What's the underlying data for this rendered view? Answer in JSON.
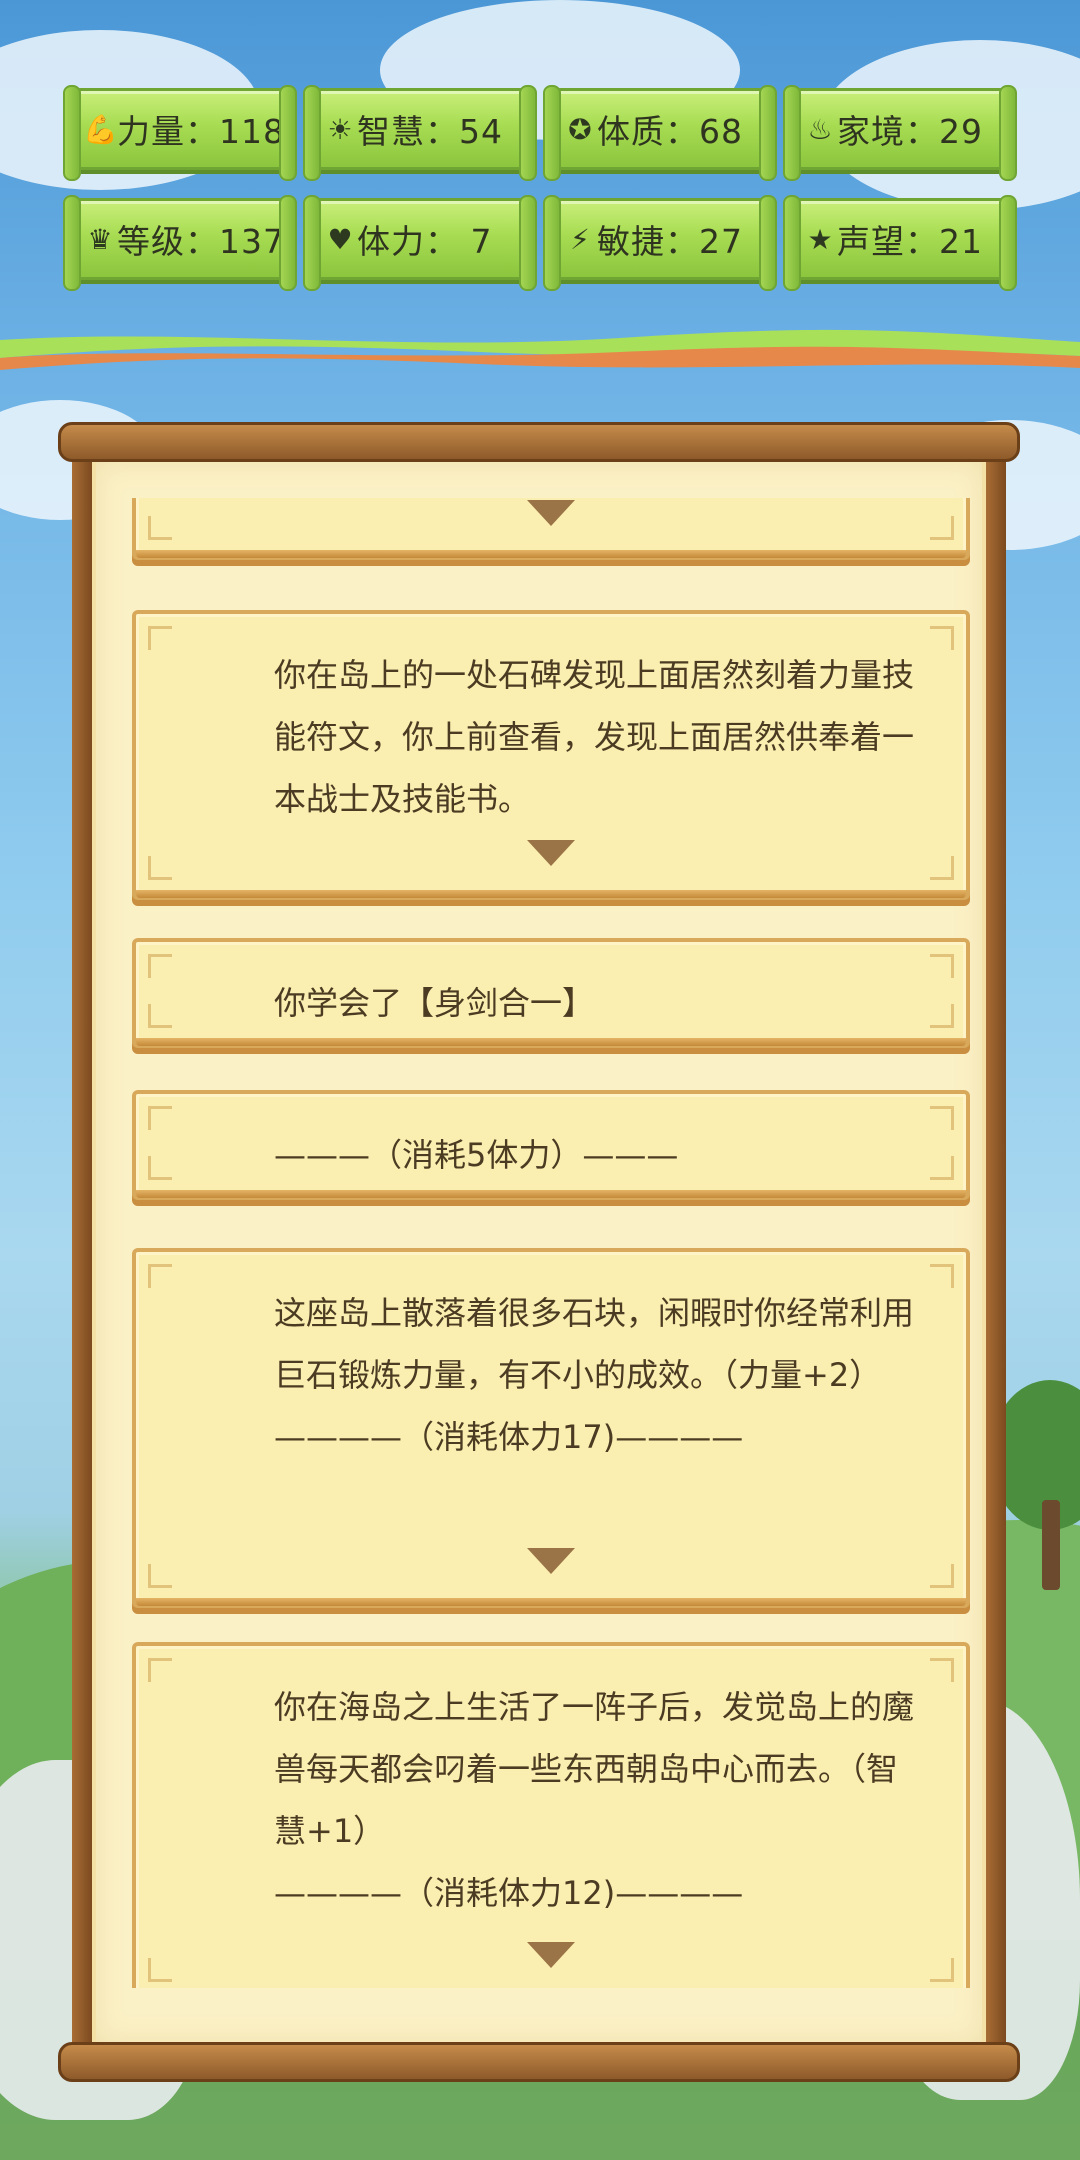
{
  "stats": [
    {
      "icon": "muscle-icon",
      "glyph": "💪",
      "text": "力量：118"
    },
    {
      "icon": "sun-icon",
      "glyph": "☀",
      "text": "智慧：54"
    },
    {
      "icon": "constitution-icon",
      "glyph": "✪",
      "text": "体质：68"
    },
    {
      "icon": "family-icon",
      "glyph": "♨",
      "text": "家境：29"
    },
    {
      "icon": "crown-icon",
      "glyph": "♛",
      "text": "等级：137"
    },
    {
      "icon": "heart-icon",
      "glyph": "♥",
      "text": "体力：  7"
    },
    {
      "icon": "lightning-icon",
      "glyph": "⚡",
      "text": "敏捷：27"
    },
    {
      "icon": "star-icon",
      "glyph": "★",
      "text": "声望：21"
    }
  ],
  "log": [
    {
      "text": "",
      "arrow": true
    },
    {
      "text": "你在岛上的一处石碑发现上面居然刻着力量技能符文，你上前查看，发现上面居然供奉着一本战士及技能书。",
      "arrow": true
    },
    {
      "text": "你学会了【身剑合一】",
      "arrow": false
    },
    {
      "text": "———（消耗5体力）———",
      "arrow": false
    },
    {
      "text": "这座岛上散落着很多石块，闲暇时你经常利用巨石锻炼力量，有不小的成效。（力量+2）\n————（消耗体力17)————",
      "arrow": true
    },
    {
      "text": "你在海岛之上生活了一阵子后，发觉岛上的魔兽每天都会叼着一些东西朝岛中心而去。（智慧+1）\n————（消耗体力12)————",
      "arrow": true
    }
  ],
  "colors": {
    "accent": "#8cc63e",
    "paper": "#faeeb0",
    "border": "#d9a95b",
    "text": "#4b3b22"
  }
}
